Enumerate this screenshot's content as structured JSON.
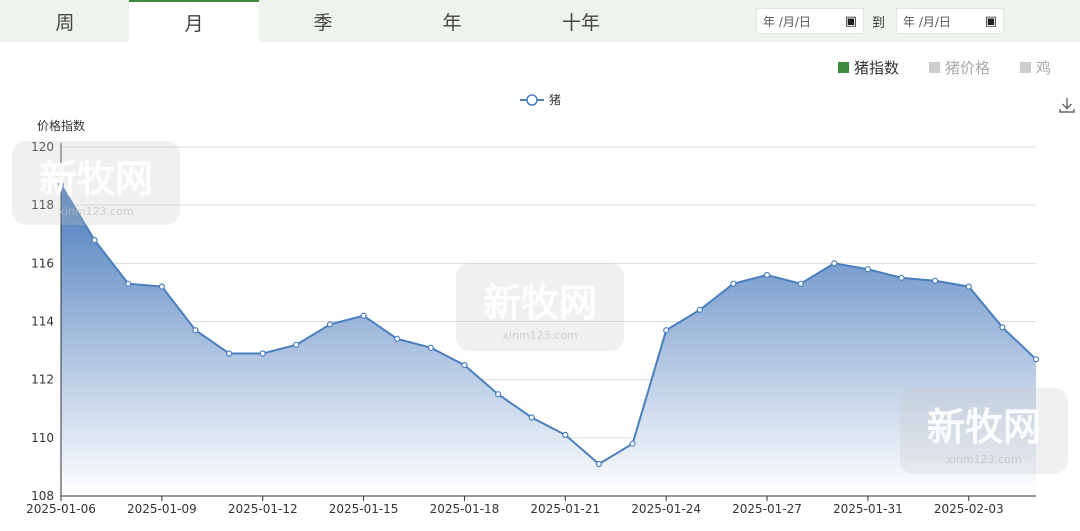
{
  "tabs": [
    {
      "label": "周",
      "active": false
    },
    {
      "label": "月",
      "active": true
    },
    {
      "label": "季",
      "active": false
    },
    {
      "label": "年",
      "active": false
    },
    {
      "label": "十年",
      "active": false
    }
  ],
  "date_range": {
    "start_placeholder": "年 /月/日",
    "to_label": "到",
    "end_placeholder": "年 /月/日"
  },
  "selectors": [
    {
      "label": "猪指数",
      "color": "#3c8a3c",
      "active": true
    },
    {
      "label": "猪价格",
      "color": "#cccccc",
      "active": false
    },
    {
      "label": "鸡",
      "color": "#cccccc",
      "active": false
    }
  ],
  "watermark": {
    "text": "新牧网",
    "sub": "xinm123.com"
  },
  "chart_data": {
    "type": "area",
    "ylabel": "价格指数",
    "ylim": [
      108,
      120
    ],
    "yticks": [
      108,
      110,
      112,
      114,
      116,
      118,
      120
    ],
    "grid": true,
    "legend_position": "top-center",
    "x": [
      "2025-01-06",
      "2025-01-07",
      "2025-01-08",
      "2025-01-09",
      "2025-01-10",
      "2025-01-11",
      "2025-01-12",
      "2025-01-13",
      "2025-01-14",
      "2025-01-15",
      "2025-01-16",
      "2025-01-17",
      "2025-01-18",
      "2025-01-19",
      "2025-01-20",
      "2025-01-21",
      "2025-01-22",
      "2025-01-23",
      "2025-01-24",
      "2025-01-25",
      "2025-01-26",
      "2025-01-27",
      "2025-01-28",
      "2025-01-29",
      "2025-01-30",
      "2025-01-31",
      "2025-02-01",
      "2025-02-02",
      "2025-02-03",
      "2025-02-04"
    ],
    "xtick_labels": [
      "2025-01-06",
      "2025-01-09",
      "2025-01-12",
      "2025-01-15",
      "2025-01-18",
      "2025-01-21",
      "2025-01-24",
      "2025-01-27",
      "2025-01-31",
      "2025-02-03"
    ],
    "xtick_dates": [
      "2025-01-06",
      "2025-01-09",
      "2025-01-12",
      "2025-01-15",
      "2025-01-18",
      "2025-01-21",
      "2025-01-24",
      "2025-01-27",
      "2025-01-30",
      "2025-02-02"
    ],
    "series": [
      {
        "name": "猪",
        "color": "#4a7fbd",
        "values": [
          118.7,
          116.8,
          115.3,
          115.2,
          113.7,
          112.9,
          112.9,
          113.2,
          113.9,
          114.2,
          113.4,
          113.1,
          112.5,
          111.5,
          110.7,
          110.1,
          109.1,
          109.8,
          113.7,
          114.4,
          115.3,
          115.6,
          115.3,
          116.0,
          115.8,
          115.5,
          115.4,
          115.2,
          113.8,
          112.7
        ]
      }
    ]
  }
}
